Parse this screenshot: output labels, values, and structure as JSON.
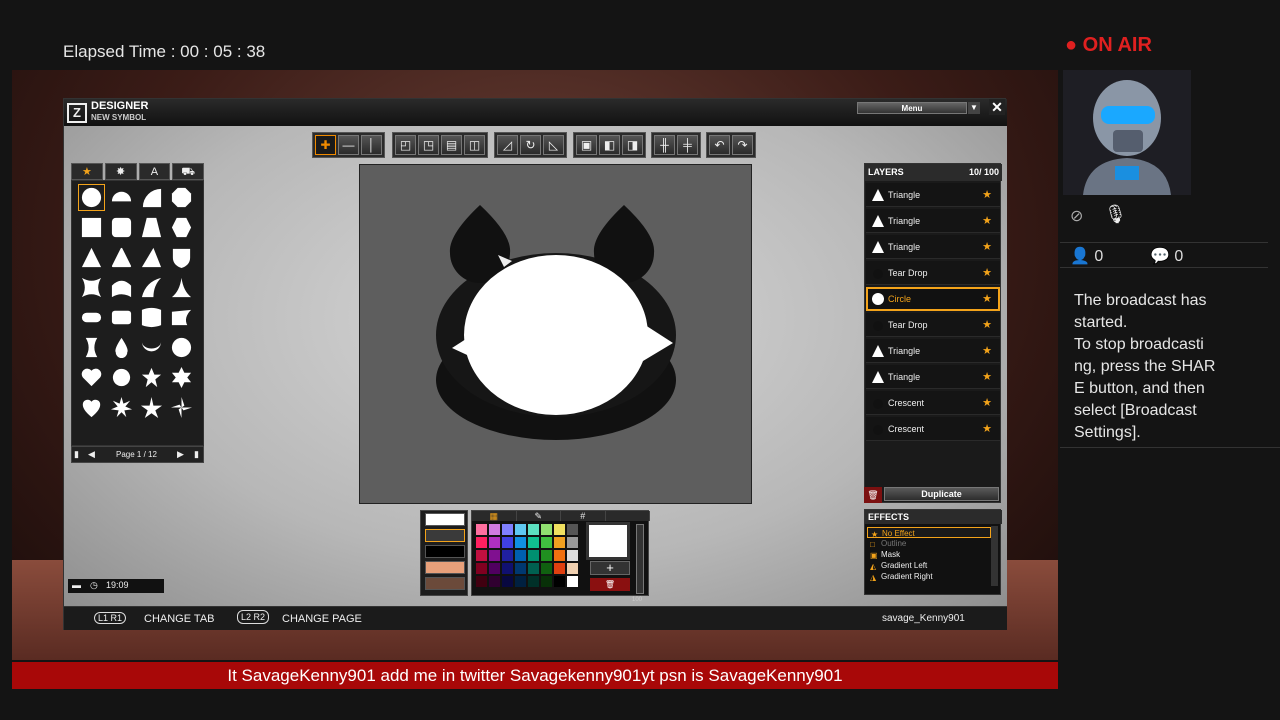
{
  "elapsed": "Elapsed Time : 00 : 05 : 38",
  "designer": {
    "title": "DESIGNER",
    "subtitle": "NEW SYMBOL",
    "menu": "Menu"
  },
  "toolbar": {
    "groups": [
      [
        "plus-cross-icon",
        "minus-icon",
        "vertical-bar-icon"
      ],
      [
        "align-top-left-icon",
        "align-top-right-icon",
        "align-bottom-icon",
        "align-center-icon"
      ],
      [
        "rotate-left-icon",
        "rotate-cycle-icon",
        "rotate-right-icon"
      ],
      [
        "square-icon",
        "layer-front-icon",
        "layer-back-icon"
      ],
      [
        "snap-horizontal-icon",
        "snap-vertical-icon"
      ],
      [
        "undo-icon",
        "redo-icon"
      ]
    ]
  },
  "shapes": {
    "tabs": [
      "★",
      "✸",
      "A",
      "⛟"
    ],
    "page": "Page 1 / 12"
  },
  "layers": {
    "title": "LAYERS",
    "count": "10/ 100",
    "items": [
      {
        "name": "Triangle",
        "icon": "triangle"
      },
      {
        "name": "Triangle",
        "icon": "triangle"
      },
      {
        "name": "Triangle",
        "icon": "triangle"
      },
      {
        "name": "Tear Drop",
        "icon": "dark"
      },
      {
        "name": "Circle",
        "icon": "circle"
      },
      {
        "name": "Tear Drop",
        "icon": "dark"
      },
      {
        "name": "Triangle",
        "icon": "triangle"
      },
      {
        "name": "Triangle",
        "icon": "triangle"
      },
      {
        "name": "Crescent",
        "icon": "dark"
      },
      {
        "name": "Crescent",
        "icon": "dark"
      }
    ],
    "duplicate": "Duplicate"
  },
  "effects": {
    "title": "EFFECTS",
    "items": [
      "No Effect",
      "Outline",
      "Mask",
      "Gradient Left",
      "Gradient Right"
    ]
  },
  "palette": {
    "tabs": [
      "▦",
      "✎",
      "#",
      ""
    ],
    "slider_value": "100",
    "add": "+",
    "delete": "🗑"
  },
  "footer": {
    "l1r1": "L1 R1",
    "change_tab": "CHANGE TAB",
    "l2r2": "L2 R2",
    "change_page": "CHANGE PAGE",
    "username": "savage_Kenny901",
    "clock": "19:09"
  },
  "broadcast": {
    "on_air": "ON AIR",
    "viewers": "0",
    "comments": "0",
    "message": "The broadcast has\nstarted.\nTo stop broadcasti\nng, press the SHAR\nE button, and then\nselect [Broadcast\nSettings]."
  },
  "ticker": "It SavageKenny901 add me in twitter Savagekenny901yt psn is SavageKenny901"
}
